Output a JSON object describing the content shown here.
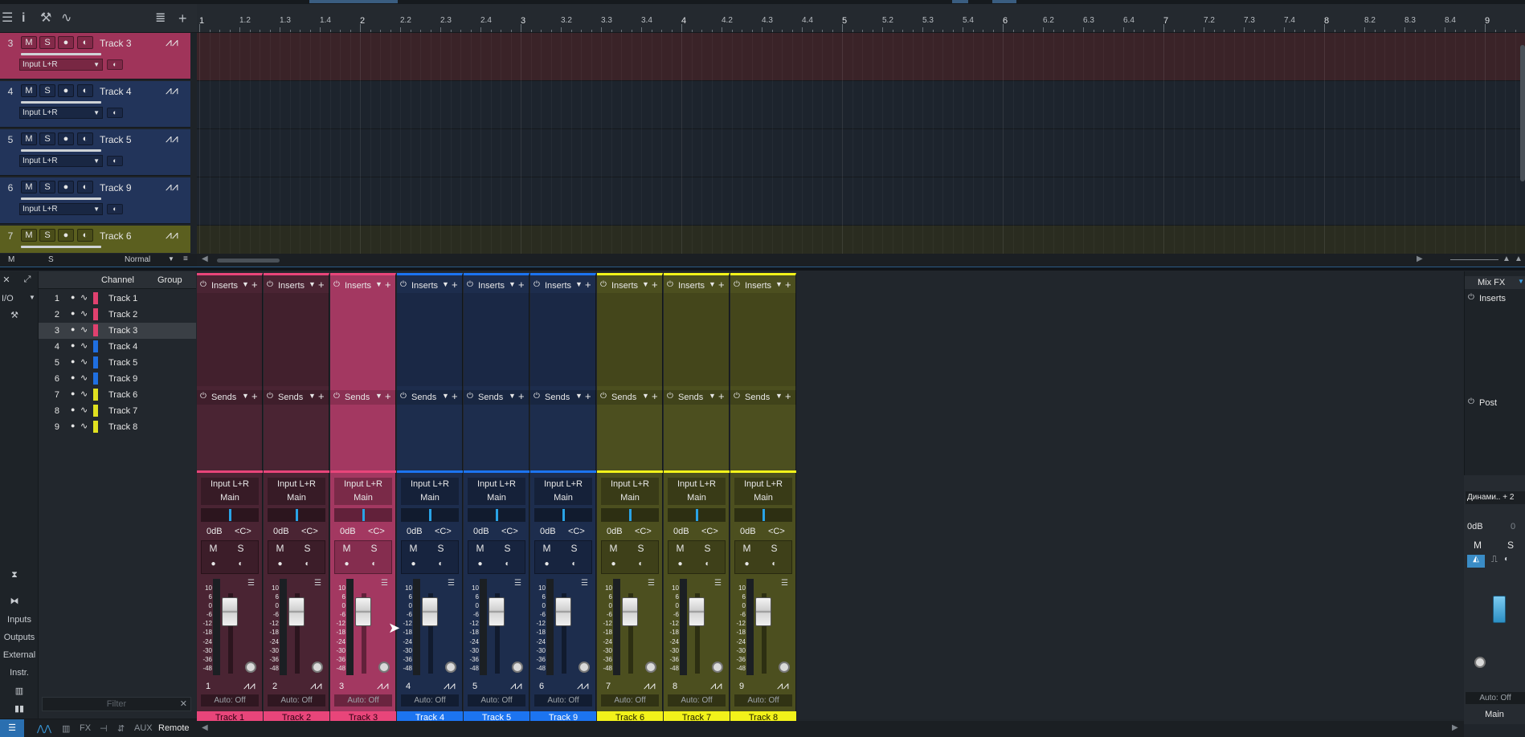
{
  "toolbar": {
    "icons": [
      "menu-icon",
      "info-icon",
      "wrench-icon",
      "automation-icon",
      "list-icon",
      "plus-icon"
    ]
  },
  "ruler": {
    "labels": [
      "1",
      "1.2",
      "1.3",
      "1.4",
      "2",
      "2.2",
      "2.3",
      "2.4",
      "3",
      "3.2",
      "3.3",
      "3.4",
      "4",
      "4.2",
      "4.3",
      "4.4",
      "5",
      "5.2",
      "5.3",
      "5.4",
      "6",
      "6.2",
      "6.3",
      "6.4",
      "7",
      "7.2",
      "7.3",
      "7.4",
      "8",
      "8.2",
      "8.3",
      "8.4",
      "9"
    ]
  },
  "tracks": [
    {
      "num": "3",
      "name": "Track 3",
      "input": "Input L+R",
      "color": "#a0345a",
      "selected": true
    },
    {
      "num": "4",
      "name": "Track 4",
      "input": "Input L+R",
      "color": "#22345a"
    },
    {
      "num": "5",
      "name": "Track 5",
      "input": "Input L+R",
      "color": "#22345a"
    },
    {
      "num": "6",
      "name": "Track 9",
      "input": "Input L+R",
      "color": "#22345a"
    },
    {
      "num": "7",
      "name": "Track 6",
      "input": "",
      "color": "#5b5f1f"
    }
  ],
  "track_buttons": {
    "mute": "M",
    "solo": "S"
  },
  "tracklist_footer": {
    "m": "M",
    "s": "S",
    "mode": "Normal"
  },
  "left_column": {
    "io": "I/O",
    "inputs": "Inputs",
    "outputs": "Outputs",
    "external": "External",
    "instr": "Instr."
  },
  "channel_list": {
    "header_channel": "Channel",
    "header_group": "Group",
    "rows": [
      {
        "num": "1",
        "name": "Track 1",
        "color": "#e0416f"
      },
      {
        "num": "2",
        "name": "Track 2",
        "color": "#e0416f"
      },
      {
        "num": "3",
        "name": "Track 3",
        "color": "#e0416f"
      },
      {
        "num": "4",
        "name": "Track 4",
        "color": "#1f6fe0"
      },
      {
        "num": "5",
        "name": "Track 5",
        "color": "#1f6fe0"
      },
      {
        "num": "6",
        "name": "Track 9",
        "color": "#1f6fe0"
      },
      {
        "num": "7",
        "name": "Track 6",
        "color": "#e0e020"
      },
      {
        "num": "8",
        "name": "Track 7",
        "color": "#e0e020"
      },
      {
        "num": "9",
        "name": "Track 8",
        "color": "#e0e020"
      }
    ],
    "filter_placeholder": "Filter"
  },
  "bottom_bar": {
    "remote": "Remote",
    "fx": "FX",
    "aux": "AUX"
  },
  "mixer": {
    "inserts_label": "Inserts",
    "sends_label": "Sends",
    "input": "Input L+R",
    "output": "Main",
    "volume": "0dB",
    "pan": "<C>",
    "mute": "M",
    "solo": "S",
    "auto": "Auto: Off",
    "scale": [
      "10",
      "6",
      "0",
      "-6",
      "-12",
      "-18",
      "-24",
      "-30",
      "-36",
      "-48"
    ],
    "strips": [
      {
        "num": "1",
        "name": "Track 1",
        "bg": "#4a2433",
        "name_bg": "#e8457a",
        "name_color": "#2a0010",
        "fader": 0.75
      },
      {
        "num": "2",
        "name": "Track 2",
        "bg": "#4a2433",
        "name_bg": "#e8457a",
        "name_color": "#2a0010",
        "fader": 0.75
      },
      {
        "num": "3",
        "name": "Track 3",
        "bg": "#a33861",
        "name_bg": "#e8457a",
        "name_color": "#2a0010",
        "fader": 0.75,
        "selected": true
      },
      {
        "num": "4",
        "name": "Track 4",
        "bg": "#1d2d4d",
        "name_bg": "#1c74f0",
        "name_color": "#ffffff",
        "fader": 0.75
      },
      {
        "num": "5",
        "name": "Track 5",
        "bg": "#1d2d4d",
        "name_bg": "#1c74f0",
        "name_color": "#ffffff",
        "fader": 0.75
      },
      {
        "num": "6",
        "name": "Track 9",
        "bg": "#1d2d4d",
        "name_bg": "#1c74f0",
        "name_color": "#ffffff",
        "fader": 0.75
      },
      {
        "num": "7",
        "name": "Track 6",
        "bg": "#4c4f1f",
        "name_bg": "#f2f21a",
        "name_color": "#202000",
        "fader": 0.75
      },
      {
        "num": "8",
        "name": "Track 7",
        "bg": "#4c4f1f",
        "name_bg": "#f2f21a",
        "name_color": "#202000",
        "fader": 0.75
      },
      {
        "num": "9",
        "name": "Track 8",
        "bg": "#4c4f1f",
        "name_bg": "#f2f21a",
        "name_color": "#202000",
        "fader": 0.75
      }
    ]
  },
  "mixfx": {
    "title": "Mix FX",
    "inserts": "Inserts",
    "post": "Post",
    "plugin": "Динами.. + 2",
    "volume": "0dB",
    "vol2": "0",
    "mute": "M",
    "solo": "S",
    "auto": "Auto: Off",
    "name": "Main"
  }
}
